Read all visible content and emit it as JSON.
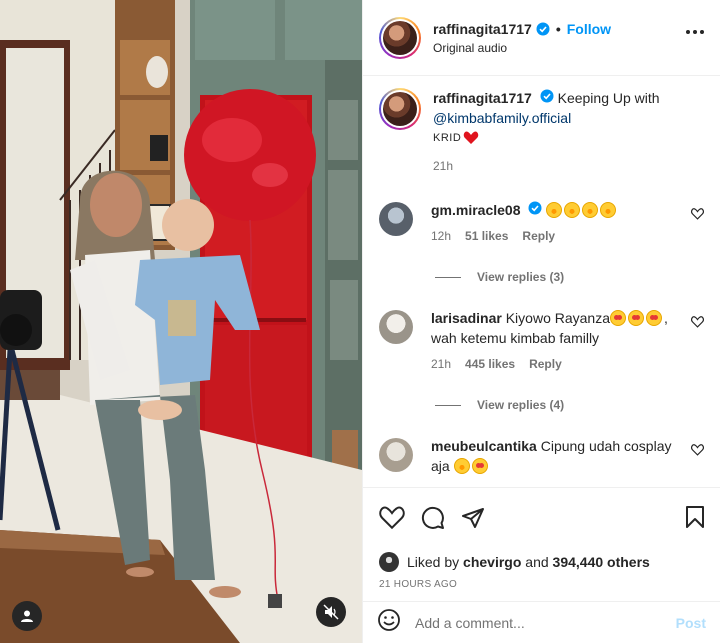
{
  "post": {
    "author": "raffinagita1717",
    "follow_label": "Follow",
    "dot": "•",
    "audio": "Original audio",
    "caption_text": "Keeping Up with",
    "caption_mention": "@kimbabfamily.official",
    "caption_small": "KRID",
    "caption_time": "21h"
  },
  "comments": [
    {
      "user": "gm.miracle08",
      "verified": true,
      "text": "",
      "emojis": [
        "laugh",
        "laugh",
        "laugh",
        "laugh"
      ],
      "time": "12h",
      "likes": "51 likes",
      "reply": "Reply",
      "view_replies": "View replies (3)"
    },
    {
      "user": "larisadinar",
      "text_before": "Kiyowo Rayanza",
      "text_after": ", wah ketemu kimbab familly",
      "time": "21h",
      "likes": "445 likes",
      "reply": "Reply",
      "view_replies": "View replies (4)"
    },
    {
      "user": "meubeulcantika",
      "text": "Cipung udah cosplay aja"
    }
  ],
  "likes": {
    "prefix": "Liked by",
    "user": "chevirgo",
    "and": "and",
    "count": "394,440 others"
  },
  "posted_ago": "21 HOURS AGO",
  "composer": {
    "placeholder": "Add a comment...",
    "post_label": "Post"
  },
  "colors": {
    "accent": "#0095f6",
    "post_disabled": "#b2dffc",
    "heart": "#ed4956",
    "text_secondary": "#737373"
  },
  "icons": [
    "verified-badge-icon",
    "more-options-icon",
    "heart-icon",
    "comment-icon",
    "share-icon",
    "bookmark-icon",
    "emoji-icon",
    "user-tag-icon",
    "mute-icon"
  ]
}
